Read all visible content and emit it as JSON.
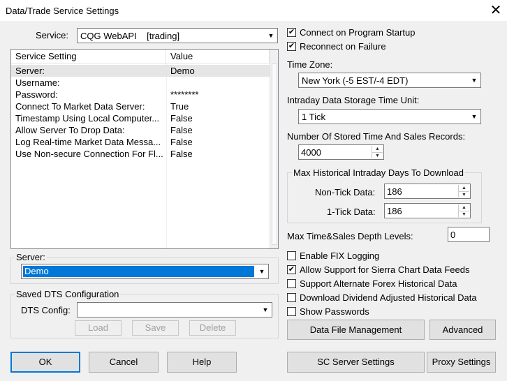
{
  "window": {
    "title": "Data/Trade Service Settings",
    "close_glyph": "✕"
  },
  "service": {
    "label": "Service:",
    "value": "CQG WebAPI    [trading]"
  },
  "settings_table": {
    "headers": [
      "Service Setting",
      "Value"
    ],
    "rows": [
      {
        "setting": "Server:",
        "value": "Demo"
      },
      {
        "setting": "Username:",
        "value": ""
      },
      {
        "setting": "Password:",
        "value": "********"
      },
      {
        "setting": "Connect To Market Data Server:",
        "value": "True"
      },
      {
        "setting": "Timestamp Using Local Computer...",
        "value": "False"
      },
      {
        "setting": "Allow Server To Drop Data:",
        "value": "False"
      },
      {
        "setting": "Log Real-time Market Data Messa...",
        "value": "False"
      },
      {
        "setting": "Use Non-secure Connection For Fl...",
        "value": "False"
      }
    ]
  },
  "server_group": {
    "title": "Server:",
    "value": "Demo"
  },
  "dts_group": {
    "title": "Saved DTS Configuration",
    "config_label": "DTS Config:",
    "config_value": "",
    "load": "Load",
    "save": "Save",
    "delete": "Delete"
  },
  "bottom_left_buttons": {
    "ok": "OK",
    "cancel": "Cancel",
    "help": "Help"
  },
  "options": {
    "connect_on_startup": {
      "label": "Connect on Program Startup",
      "checked": true
    },
    "reconnect_on_failure": {
      "label": "Reconnect on Failure",
      "checked": true
    }
  },
  "time_zone": {
    "label": "Time Zone:",
    "value": "New York (-5 EST/-4 EDT)"
  },
  "intraday_unit": {
    "label": "Intraday Data Storage Time Unit:",
    "value": "1 Tick"
  },
  "stored_records": {
    "label": "Number Of Stored Time And Sales Records:",
    "value": "4000"
  },
  "historical_group": {
    "title": "Max Historical Intraday Days To Download",
    "non_tick_label": "Non-Tick Data:",
    "non_tick_value": "186",
    "one_tick_label": "1-Tick Data:",
    "one_tick_value": "186"
  },
  "depth_levels": {
    "label": "Max Time&Sales Depth Levels:",
    "value": "0"
  },
  "checks": [
    {
      "label": "Enable FIX Logging",
      "checked": false
    },
    {
      "label": "Allow Support for Sierra Chart Data Feeds",
      "checked": true
    },
    {
      "label": "Support Alternate Forex Historical Data",
      "checked": false
    },
    {
      "label": "Download Dividend Adjusted Historical Data",
      "checked": false
    },
    {
      "label": "Show Passwords",
      "checked": false
    }
  ],
  "right_buttons": {
    "data_file_management": "Data File Management",
    "advanced": "Advanced",
    "sc_server_settings": "SC Server Settings",
    "proxy_settings": "Proxy Settings"
  },
  "icons": {
    "dropdown": "chevron-down-icon",
    "check": "checkmark-icon",
    "spin_up": "spin-up-icon",
    "spin_down": "spin-down-icon"
  },
  "glyphs": {
    "dropdown": "▼",
    "check": "✔",
    "up": "▲",
    "down": "▼"
  }
}
